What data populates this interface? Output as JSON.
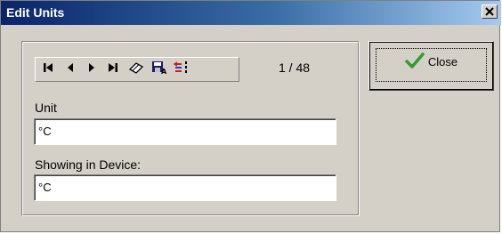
{
  "window": {
    "title": "Edit Units",
    "close_glyph": "✕"
  },
  "toolbar": {
    "buttons": [
      {
        "name": "first-record",
        "icon": "first-record-icon"
      },
      {
        "name": "previous-record",
        "icon": "prev-arrow-icon"
      },
      {
        "name": "next-record",
        "icon": "next-arrow-icon"
      },
      {
        "name": "last-record",
        "icon": "last-record-icon"
      },
      {
        "name": "edit-record",
        "icon": "eraser-icon"
      },
      {
        "name": "save-record",
        "icon": "save-disk-icon"
      },
      {
        "name": "cancel-changes",
        "icon": "cancel-edit-icon"
      }
    ],
    "counter": "1 / 48"
  },
  "form": {
    "unit_label": "Unit",
    "unit_value": "°C",
    "showing_label": "Showing in Device:",
    "showing_value": "°C"
  },
  "close_button": {
    "label": "Close",
    "icon": "checkmark-icon",
    "icon_color": "#2e9e2e"
  }
}
